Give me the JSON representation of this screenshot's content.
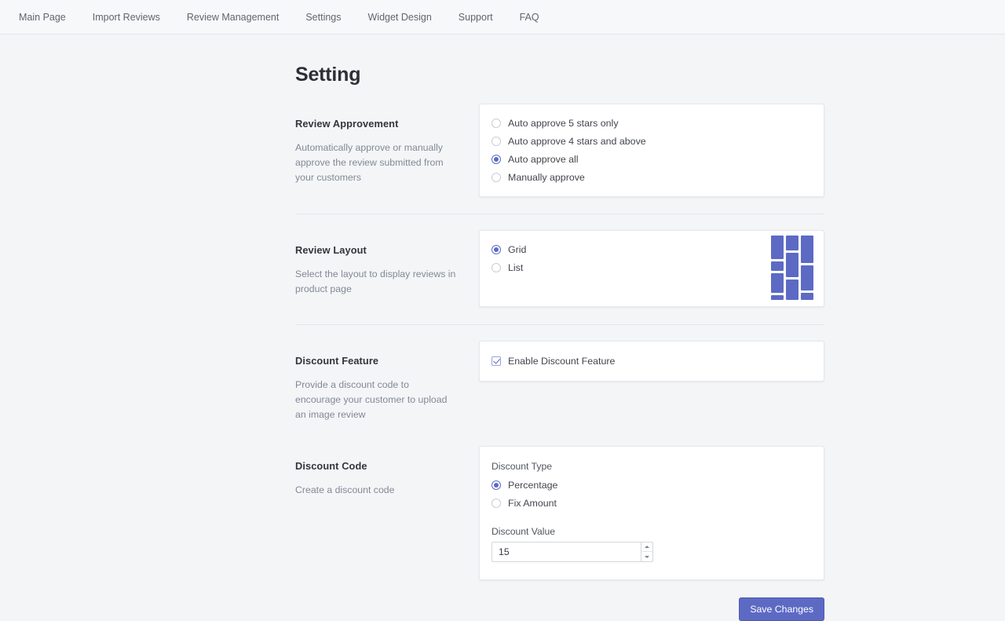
{
  "nav": {
    "items": [
      {
        "label": "Main Page"
      },
      {
        "label": "Import Reviews"
      },
      {
        "label": "Review Management"
      },
      {
        "label": "Settings"
      },
      {
        "label": "Widget Design"
      },
      {
        "label": "Support"
      },
      {
        "label": "FAQ"
      }
    ]
  },
  "page": {
    "title": "Setting"
  },
  "sections": {
    "approvement": {
      "title": "Review Approvement",
      "description": "Automatically approve or manually approve the review submitted from your customers",
      "options": [
        {
          "label": "Auto approve 5 stars only",
          "selected": false
        },
        {
          "label": "Auto approve 4 stars and above",
          "selected": false
        },
        {
          "label": "Auto approve all",
          "selected": true
        },
        {
          "label": "Manually approve",
          "selected": false
        }
      ]
    },
    "layout": {
      "title": "Review Layout",
      "description": "Select the layout to display reviews in product page",
      "options": [
        {
          "label": "Grid",
          "selected": true
        },
        {
          "label": "List",
          "selected": false
        }
      ],
      "preview_icon": "grid-layout-preview"
    },
    "discount_feature": {
      "title": "Discount Feature",
      "description": "Provide a discount code to encourage your customer to upload an image review",
      "checkbox_label": "Enable Discount Feature",
      "checked": true
    },
    "discount_code": {
      "title": "Discount Code",
      "description": "Create a discount code",
      "type_label": "Discount Type",
      "options": [
        {
          "label": "Percentage",
          "selected": true
        },
        {
          "label": "Fix Amount",
          "selected": false
        }
      ],
      "value_label": "Discount Value",
      "value": "15",
      "value_placeholder": "",
      "stepper_up": "increment-icon",
      "stepper_down": "decrement-icon"
    }
  },
  "footer": {
    "save_label": "Save Changes"
  },
  "colors": {
    "accent": "#5c6ac4",
    "page_background": "#f4f5f7",
    "card_background": "#ffffff",
    "border": "#e6e8ec",
    "heading_text": "#2c2f36",
    "muted_text": "#818a96"
  }
}
